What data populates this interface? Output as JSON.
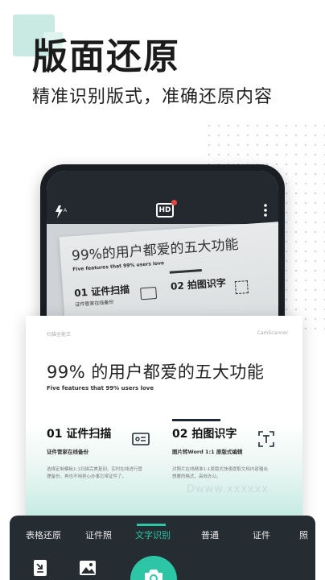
{
  "hero": {
    "title": "版面还原",
    "subtitle": "精准识别版式，准确还原内容"
  },
  "app_bar": {
    "flash_label": "A",
    "hd_label": "HD"
  },
  "photo_document": {
    "title": "99%的用户都爱的五大功能",
    "subtitle": "Five features that 99% users love",
    "feature1_title": "01 证件扫描",
    "feature1_sub": "证件管家在线备份",
    "feature2_title": "02 拍图识字"
  },
  "document": {
    "header_left": "扫描全能王",
    "header_right": "CamScanner",
    "title": "99% 的用户都爱的五大功能",
    "subtitle": "Five features that 99% users love",
    "features": [
      {
        "title": "01 证件扫描",
        "subtitle": "证件管家在线备份",
        "description": "选择定制模板1:1扫描完美复刻，实时在线进行管理备份，再也不用担心办事忘带证件了。"
      },
      {
        "title": "02 拍图识字",
        "subtitle": "图片转Word 1:1 原版式编辑",
        "description": "对照片在线精准1:1原版式快速提取文档内容输出想要的格式，高效办公。"
      }
    ]
  },
  "mode_tabs": {
    "items": [
      "表格还原",
      "证件照",
      "文字识别",
      "普通",
      "证件",
      "照"
    ],
    "active": "文字识别"
  },
  "colors": {
    "accent": "#2cc6a6",
    "dark": "#252c32"
  },
  "icons": {
    "flash": "flash-auto-icon",
    "hd": "hd-icon",
    "more": "more-vertical-icon",
    "import_doc": "import-document-icon",
    "gallery": "gallery-icon",
    "shutter": "camera-icon"
  },
  "watermark": "Dwww.xxxxxx"
}
